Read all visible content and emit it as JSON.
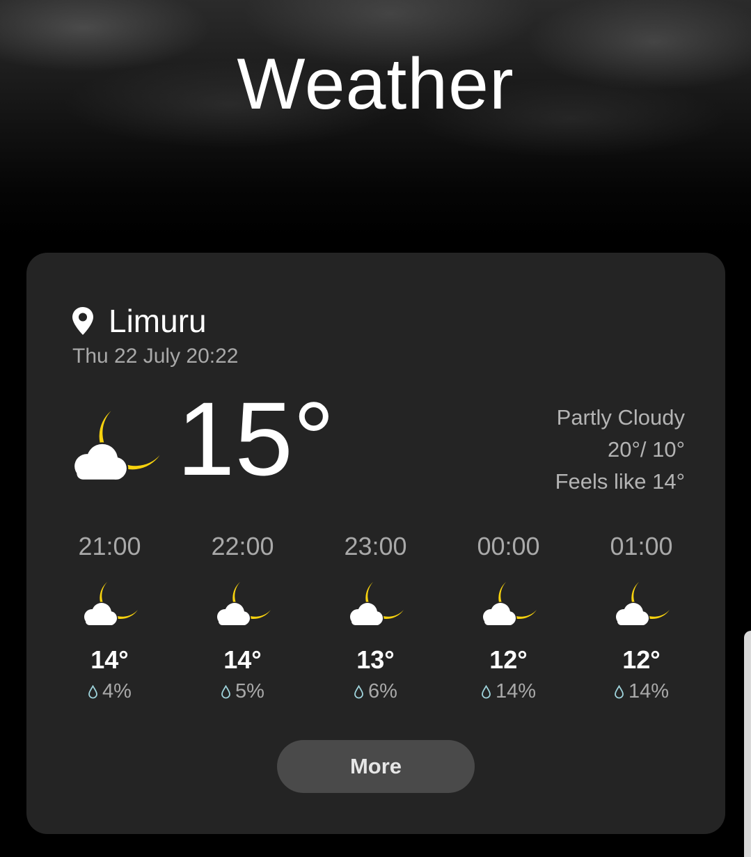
{
  "app": {
    "title": "Weather"
  },
  "colors": {
    "moon": "#f7d20e",
    "cloud": "#ffffff",
    "card": "#242424",
    "drop": "#9fd4dc"
  },
  "current": {
    "location": "Limuru",
    "datetime": "Thu 22 July 20:22",
    "icon": "partly-cloudy-night-icon",
    "temperature": "15°",
    "condition": "Partly Cloudy",
    "high_low": "20°/ 10°",
    "feels_like": "Feels like 14°"
  },
  "hourly": [
    {
      "time": "21:00",
      "icon": "partly-cloudy-night-icon",
      "temp": "14°",
      "precip": "4%"
    },
    {
      "time": "22:00",
      "icon": "partly-cloudy-night-icon",
      "temp": "14°",
      "precip": "5%"
    },
    {
      "time": "23:00",
      "icon": "partly-cloudy-night-icon",
      "temp": "13°",
      "precip": "6%"
    },
    {
      "time": "00:00",
      "icon": "partly-cloudy-night-icon",
      "temp": "12°",
      "precip": "14%"
    },
    {
      "time": "01:00",
      "icon": "partly-cloudy-night-icon",
      "temp": "12°",
      "precip": "14%"
    }
  ],
  "more_button": {
    "label": "More"
  }
}
